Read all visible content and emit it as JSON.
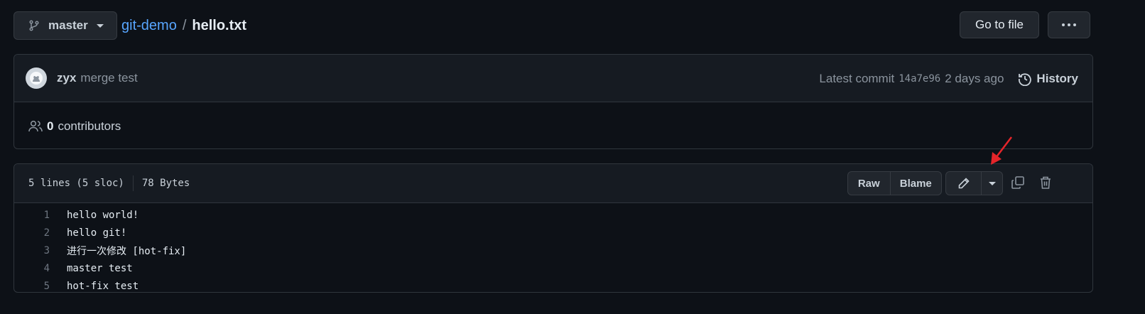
{
  "branch": {
    "name": "master"
  },
  "breadcrumb": {
    "repo": "git-demo",
    "separator": "/",
    "file": "hello.txt"
  },
  "header_actions": {
    "goto_file": "Go to file",
    "more": "more-options"
  },
  "commit": {
    "author": "zyx",
    "message": "merge test",
    "latest_label": "Latest commit",
    "sha": "14a7e96",
    "time": "2 days ago",
    "history_label": "History"
  },
  "contributors": {
    "count": "0",
    "label": "contributors"
  },
  "file": {
    "lines_info": "5 lines (5 sloc)",
    "size": "78 Bytes",
    "raw_label": "Raw",
    "blame_label": "Blame",
    "code_lines": [
      {
        "num": "1",
        "text": "hello world!"
      },
      {
        "num": "2",
        "text": "hello git!"
      },
      {
        "num": "3",
        "text": "进行一次修改 [hot-fix]"
      },
      {
        "num": "4",
        "text": "master test"
      },
      {
        "num": "5",
        "text": "hot-fix test"
      }
    ]
  },
  "colors": {
    "background": "#0d1117",
    "link": "#58a6ff",
    "annotation_arrow": "#e5252a"
  },
  "icons": [
    "branch-icon",
    "avatar-icon",
    "history-icon",
    "people-icon",
    "pencil-icon",
    "copy-icon",
    "trash-icon"
  ]
}
